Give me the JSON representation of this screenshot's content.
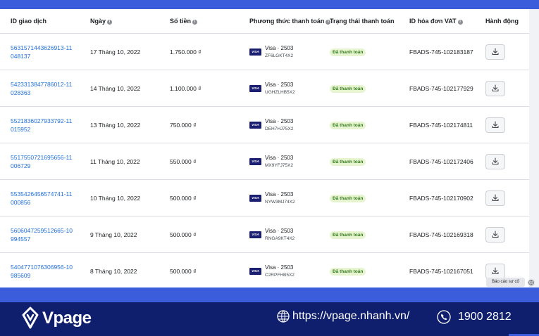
{
  "table": {
    "headers": [
      {
        "label": "ID giao dịch",
        "info": false
      },
      {
        "label": "Ngày",
        "info": true
      },
      {
        "label": "Số tiền",
        "info": true
      },
      {
        "label": "Phương thức thanh toán",
        "info": true
      },
      {
        "label": "Trạng thái thanh toán",
        "info": false
      },
      {
        "label": "ID hóa đơn VAT",
        "info": true
      },
      {
        "label": "Hành động",
        "info": false
      }
    ],
    "rows": [
      {
        "tx_id": "5631571443626913-11048137",
        "date": "17 Tháng 10, 2022",
        "amount": "1.750.000 ₫",
        "card": "Visa · 2503",
        "code": "ZF6LGKT4X2",
        "status": "Đã thanh toán",
        "vat_id": "FBADS-745-102183187"
      },
      {
        "tx_id": "5423313847786012-11028363",
        "date": "14 Tháng 10, 2022",
        "amount": "1.100.000 ₫",
        "card": "Visa · 2503",
        "code": "UGHZLHB5X2",
        "status": "Đã thanh toán",
        "vat_id": "FBADS-745-102177929"
      },
      {
        "tx_id": "5521836027933792-11015952",
        "date": "13 Tháng 10, 2022",
        "amount": "750.000 ₫",
        "card": "Visa · 2503",
        "code": "DEH7HJ75X2",
        "status": "Đã thanh toán",
        "vat_id": "FBADS-745-102174811"
      },
      {
        "tx_id": "5517550721695656-11006729",
        "date": "11 Tháng 10, 2022",
        "amount": "550.000 ₫",
        "card": "Visa · 2503",
        "code": "MX9YFJ75X2",
        "status": "Đã thanh toán",
        "vat_id": "FBADS-745-102172406"
      },
      {
        "tx_id": "5535426456574741-11000856",
        "date": "10 Tháng 10, 2022",
        "amount": "500.000 ₫",
        "card": "Visa · 2503",
        "code": "NYW3MJ74X2",
        "status": "Đã thanh toán",
        "vat_id": "FBADS-745-102170902"
      },
      {
        "tx_id": "5606047259512665-10994557",
        "date": "9 Tháng 10, 2022",
        "amount": "500.000 ₫",
        "card": "Visa · 2503",
        "code": "RNGA9KT4X2",
        "status": "Đã thanh toán",
        "vat_id": "FBADS-745-102169318"
      },
      {
        "tx_id": "5404771076306956-10985609",
        "date": "8 Tháng 10, 2022",
        "amount": "500.000 ₫",
        "card": "Visa · 2503",
        "code": "C2RPFHB5X2",
        "status": "Đã thanh toán",
        "vat_id": "FBADS-745-102167051"
      }
    ]
  },
  "visa_badge": "VISA",
  "info_icon_glyph": "i",
  "report_label": "Báo cáo sự cố",
  "footer": {
    "brand": "Vpage",
    "website": "https://vpage.nhanh.vn/",
    "phone": "1900 2812"
  },
  "colors": {
    "link": "#216fdb",
    "status_bg": "#e6f5d0",
    "status_text": "#367b1f",
    "footer_bg": "#0f1f6e",
    "accent_blue": "#3b5cdb"
  }
}
